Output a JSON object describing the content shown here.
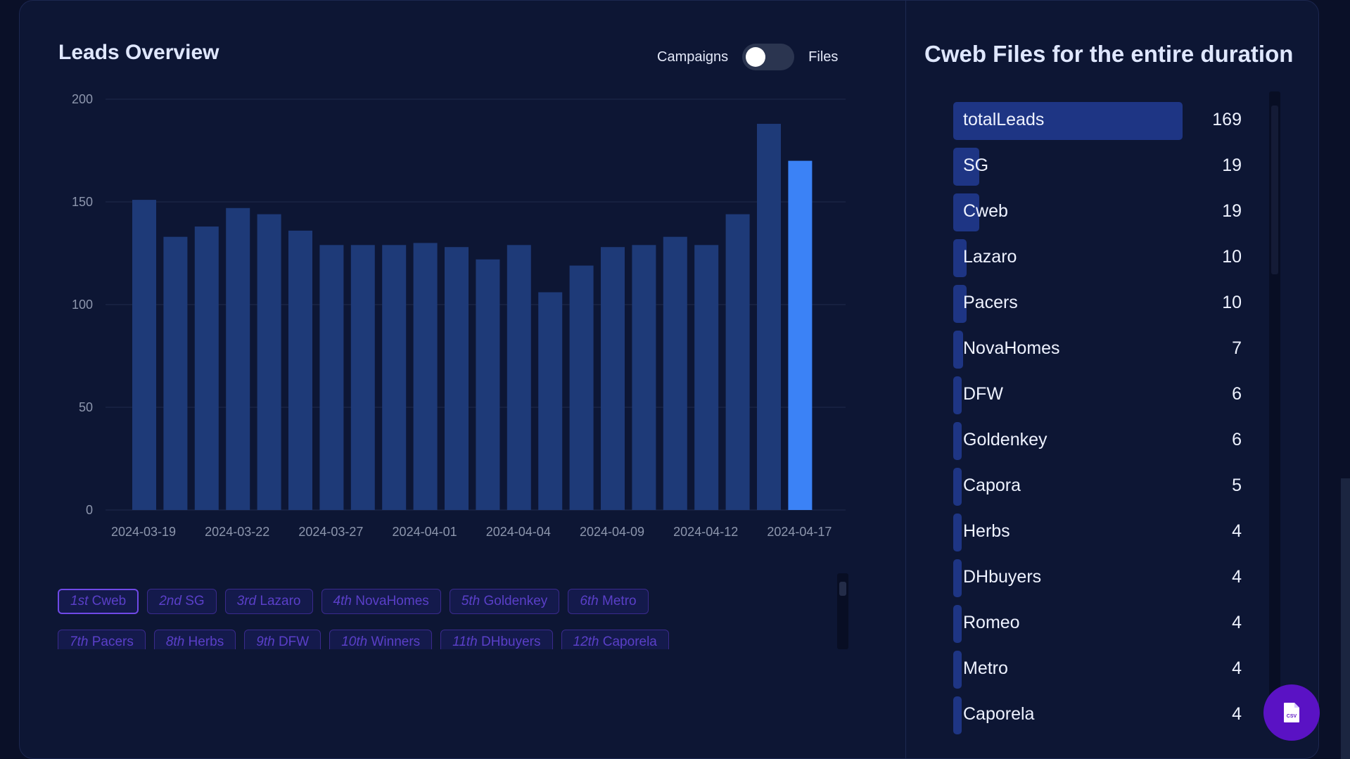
{
  "overview": {
    "title": "Leads Overview",
    "toggle": {
      "left_label": "Campaigns",
      "right_label": "Files",
      "state": "off"
    }
  },
  "chart_data": {
    "type": "bar",
    "title": "",
    "xlabel": "",
    "ylabel": "",
    "ylim": [
      0,
      200
    ],
    "yticks": [
      0,
      50,
      100,
      150,
      200
    ],
    "grid": true,
    "xtick_labels": [
      "2024-03-19",
      "2024-03-22",
      "2024-03-27",
      "2024-04-01",
      "2024-04-04",
      "2024-04-09",
      "2024-04-12",
      "2024-04-17"
    ],
    "values": [
      151,
      133,
      138,
      147,
      144,
      136,
      129,
      129,
      129,
      130,
      128,
      122,
      129,
      106,
      119,
      128,
      129,
      133,
      129,
      144,
      188,
      170
    ],
    "highlight_index": 21,
    "colors": {
      "bar": "#1e3a78",
      "highlight": "#3b82f6",
      "grid": "#1f2a4d"
    }
  },
  "rankings": {
    "row1": [
      {
        "ord": "1st",
        "name": "Cweb",
        "active": true
      },
      {
        "ord": "2nd",
        "name": "SG"
      },
      {
        "ord": "3rd",
        "name": "Lazaro"
      },
      {
        "ord": "4th",
        "name": "NovaHomes"
      },
      {
        "ord": "5th",
        "name": "Goldenkey"
      },
      {
        "ord": "6th",
        "name": "Metro"
      }
    ],
    "row2": [
      {
        "ord": "7th",
        "name": "Pacers"
      },
      {
        "ord": "8th",
        "name": "Herbs"
      },
      {
        "ord": "9th",
        "name": "DFW"
      },
      {
        "ord": "10th",
        "name": "Winners"
      },
      {
        "ord": "11th",
        "name": "DHbuyers"
      },
      {
        "ord": "12th",
        "name": "Caporela"
      }
    ]
  },
  "files_panel": {
    "title": "Cweb Files for the entire duration",
    "max": 169,
    "items": [
      {
        "name": "totalLeads",
        "value": 169
      },
      {
        "name": "SG",
        "value": 19
      },
      {
        "name": "Cweb",
        "value": 19
      },
      {
        "name": "Lazaro",
        "value": 10
      },
      {
        "name": "Pacers",
        "value": 10
      },
      {
        "name": "NovaHomes",
        "value": 7
      },
      {
        "name": "DFW",
        "value": 6
      },
      {
        "name": "Goldenkey",
        "value": 6
      },
      {
        "name": "Capora",
        "value": 5
      },
      {
        "name": "Herbs",
        "value": 4
      },
      {
        "name": "DHbuyers",
        "value": 4
      },
      {
        "name": "Romeo",
        "value": 4
      },
      {
        "name": "Metro",
        "value": 4
      },
      {
        "name": "Caporela",
        "value": 4
      }
    ]
  },
  "csv_button": {
    "icon": "csv-file-icon"
  }
}
